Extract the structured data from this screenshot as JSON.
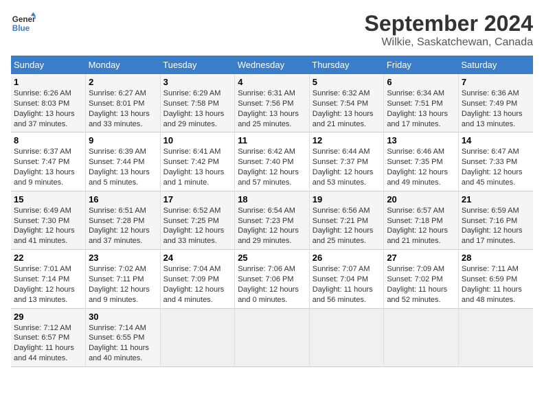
{
  "header": {
    "logo_line1": "General",
    "logo_line2": "Blue",
    "title": "September 2024",
    "subtitle": "Wilkie, Saskatchewan, Canada"
  },
  "weekdays": [
    "Sunday",
    "Monday",
    "Tuesday",
    "Wednesday",
    "Thursday",
    "Friday",
    "Saturday"
  ],
  "weeks": [
    [
      {
        "day": "1",
        "sunrise": "Sunrise: 6:26 AM",
        "sunset": "Sunset: 8:03 PM",
        "daylight": "Daylight: 13 hours and 37 minutes."
      },
      {
        "day": "2",
        "sunrise": "Sunrise: 6:27 AM",
        "sunset": "Sunset: 8:01 PM",
        "daylight": "Daylight: 13 hours and 33 minutes."
      },
      {
        "day": "3",
        "sunrise": "Sunrise: 6:29 AM",
        "sunset": "Sunset: 7:58 PM",
        "daylight": "Daylight: 13 hours and 29 minutes."
      },
      {
        "day": "4",
        "sunrise": "Sunrise: 6:31 AM",
        "sunset": "Sunset: 7:56 PM",
        "daylight": "Daylight: 13 hours and 25 minutes."
      },
      {
        "day": "5",
        "sunrise": "Sunrise: 6:32 AM",
        "sunset": "Sunset: 7:54 PM",
        "daylight": "Daylight: 13 hours and 21 minutes."
      },
      {
        "day": "6",
        "sunrise": "Sunrise: 6:34 AM",
        "sunset": "Sunset: 7:51 PM",
        "daylight": "Daylight: 13 hours and 17 minutes."
      },
      {
        "day": "7",
        "sunrise": "Sunrise: 6:36 AM",
        "sunset": "Sunset: 7:49 PM",
        "daylight": "Daylight: 13 hours and 13 minutes."
      }
    ],
    [
      {
        "day": "8",
        "sunrise": "Sunrise: 6:37 AM",
        "sunset": "Sunset: 7:47 PM",
        "daylight": "Daylight: 13 hours and 9 minutes."
      },
      {
        "day": "9",
        "sunrise": "Sunrise: 6:39 AM",
        "sunset": "Sunset: 7:44 PM",
        "daylight": "Daylight: 13 hours and 5 minutes."
      },
      {
        "day": "10",
        "sunrise": "Sunrise: 6:41 AM",
        "sunset": "Sunset: 7:42 PM",
        "daylight": "Daylight: 13 hours and 1 minute."
      },
      {
        "day": "11",
        "sunrise": "Sunrise: 6:42 AM",
        "sunset": "Sunset: 7:40 PM",
        "daylight": "Daylight: 12 hours and 57 minutes."
      },
      {
        "day": "12",
        "sunrise": "Sunrise: 6:44 AM",
        "sunset": "Sunset: 7:37 PM",
        "daylight": "Daylight: 12 hours and 53 minutes."
      },
      {
        "day": "13",
        "sunrise": "Sunrise: 6:46 AM",
        "sunset": "Sunset: 7:35 PM",
        "daylight": "Daylight: 12 hours and 49 minutes."
      },
      {
        "day": "14",
        "sunrise": "Sunrise: 6:47 AM",
        "sunset": "Sunset: 7:33 PM",
        "daylight": "Daylight: 12 hours and 45 minutes."
      }
    ],
    [
      {
        "day": "15",
        "sunrise": "Sunrise: 6:49 AM",
        "sunset": "Sunset: 7:30 PM",
        "daylight": "Daylight: 12 hours and 41 minutes."
      },
      {
        "day": "16",
        "sunrise": "Sunrise: 6:51 AM",
        "sunset": "Sunset: 7:28 PM",
        "daylight": "Daylight: 12 hours and 37 minutes."
      },
      {
        "day": "17",
        "sunrise": "Sunrise: 6:52 AM",
        "sunset": "Sunset: 7:25 PM",
        "daylight": "Daylight: 12 hours and 33 minutes."
      },
      {
        "day": "18",
        "sunrise": "Sunrise: 6:54 AM",
        "sunset": "Sunset: 7:23 PM",
        "daylight": "Daylight: 12 hours and 29 minutes."
      },
      {
        "day": "19",
        "sunrise": "Sunrise: 6:56 AM",
        "sunset": "Sunset: 7:21 PM",
        "daylight": "Daylight: 12 hours and 25 minutes."
      },
      {
        "day": "20",
        "sunrise": "Sunrise: 6:57 AM",
        "sunset": "Sunset: 7:18 PM",
        "daylight": "Daylight: 12 hours and 21 minutes."
      },
      {
        "day": "21",
        "sunrise": "Sunrise: 6:59 AM",
        "sunset": "Sunset: 7:16 PM",
        "daylight": "Daylight: 12 hours and 17 minutes."
      }
    ],
    [
      {
        "day": "22",
        "sunrise": "Sunrise: 7:01 AM",
        "sunset": "Sunset: 7:14 PM",
        "daylight": "Daylight: 12 hours and 13 minutes."
      },
      {
        "day": "23",
        "sunrise": "Sunrise: 7:02 AM",
        "sunset": "Sunset: 7:11 PM",
        "daylight": "Daylight: 12 hours and 9 minutes."
      },
      {
        "day": "24",
        "sunrise": "Sunrise: 7:04 AM",
        "sunset": "Sunset: 7:09 PM",
        "daylight": "Daylight: 12 hours and 4 minutes."
      },
      {
        "day": "25",
        "sunrise": "Sunrise: 7:06 AM",
        "sunset": "Sunset: 7:06 PM",
        "daylight": "Daylight: 12 hours and 0 minutes."
      },
      {
        "day": "26",
        "sunrise": "Sunrise: 7:07 AM",
        "sunset": "Sunset: 7:04 PM",
        "daylight": "Daylight: 11 hours and 56 minutes."
      },
      {
        "day": "27",
        "sunrise": "Sunrise: 7:09 AM",
        "sunset": "Sunset: 7:02 PM",
        "daylight": "Daylight: 11 hours and 52 minutes."
      },
      {
        "day": "28",
        "sunrise": "Sunrise: 7:11 AM",
        "sunset": "Sunset: 6:59 PM",
        "daylight": "Daylight: 11 hours and 48 minutes."
      }
    ],
    [
      {
        "day": "29",
        "sunrise": "Sunrise: 7:12 AM",
        "sunset": "Sunset: 6:57 PM",
        "daylight": "Daylight: 11 hours and 44 minutes."
      },
      {
        "day": "30",
        "sunrise": "Sunrise: 7:14 AM",
        "sunset": "Sunset: 6:55 PM",
        "daylight": "Daylight: 11 hours and 40 minutes."
      },
      null,
      null,
      null,
      null,
      null
    ]
  ]
}
